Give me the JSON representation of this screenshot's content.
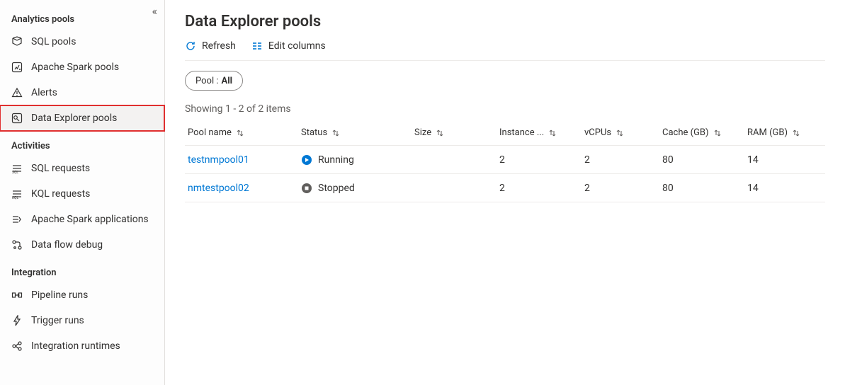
{
  "sidebar": {
    "sections": [
      {
        "title": "Analytics pools",
        "items": [
          {
            "label": "SQL pools",
            "icon": "sql-pools-icon",
            "selected": false
          },
          {
            "label": "Apache Spark pools",
            "icon": "spark-pools-icon",
            "selected": false
          },
          {
            "label": "Alerts",
            "icon": "alerts-icon",
            "selected": false
          },
          {
            "label": "Data Explorer pools",
            "icon": "data-explorer-pools-icon",
            "selected": true
          }
        ]
      },
      {
        "title": "Activities",
        "items": [
          {
            "label": "SQL requests",
            "icon": "sql-requests-icon",
            "selected": false
          },
          {
            "label": "KQL requests",
            "icon": "kql-requests-icon",
            "selected": false
          },
          {
            "label": "Apache Spark applications",
            "icon": "spark-apps-icon",
            "selected": false
          },
          {
            "label": "Data flow debug",
            "icon": "data-flow-debug-icon",
            "selected": false
          }
        ]
      },
      {
        "title": "Integration",
        "items": [
          {
            "label": "Pipeline runs",
            "icon": "pipeline-runs-icon",
            "selected": false
          },
          {
            "label": "Trigger runs",
            "icon": "trigger-runs-icon",
            "selected": false
          },
          {
            "label": "Integration runtimes",
            "icon": "integration-runtimes-icon",
            "selected": false
          }
        ]
      }
    ]
  },
  "main": {
    "title": "Data Explorer pools",
    "toolbar": {
      "refresh_label": "Refresh",
      "edit_columns_label": "Edit columns"
    },
    "filter": {
      "label": "Pool : ",
      "value": "All"
    },
    "result_text": "Showing 1 - 2 of 2 items",
    "columns": [
      {
        "label": "Pool name"
      },
      {
        "label": "Status"
      },
      {
        "label": "Size"
      },
      {
        "label": "Instance ..."
      },
      {
        "label": "vCPUs"
      },
      {
        "label": "Cache (GB)"
      },
      {
        "label": "RAM (GB)"
      }
    ],
    "rows": [
      {
        "name": "testnmpool01",
        "status": "Running",
        "status_kind": "running",
        "size": "",
        "instances": "2",
        "vcpus": "2",
        "cache_gb": "80",
        "ram_gb": "14"
      },
      {
        "name": "nmtestpool02",
        "status": "Stopped",
        "status_kind": "stopped",
        "size": "",
        "instances": "2",
        "vcpus": "2",
        "cache_gb": "80",
        "ram_gb": "14"
      }
    ]
  }
}
